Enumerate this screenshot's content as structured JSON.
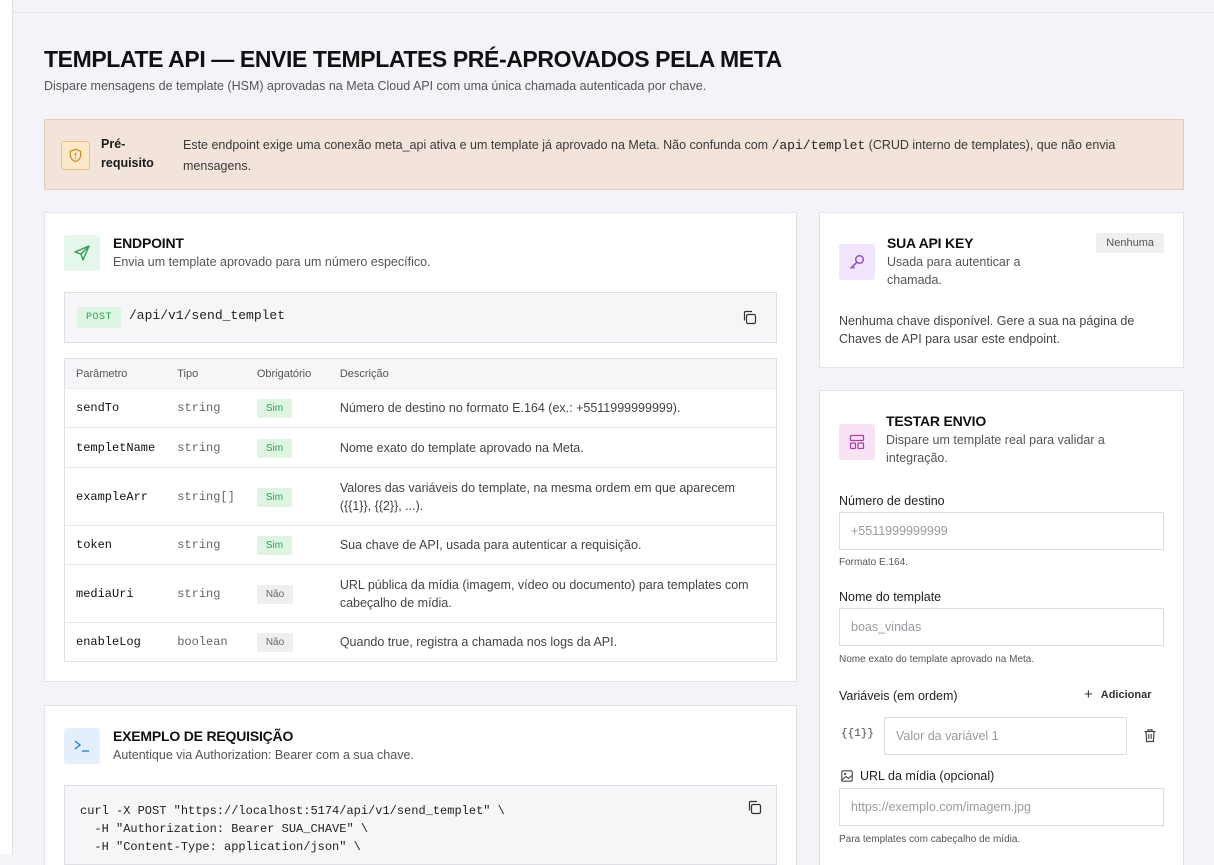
{
  "page": {
    "title": "TEMPLATE API — ENVIE TEMPLATES PRÉ-APROVADOS PELA META",
    "subtitle": "Dispare mensagens de template (HSM) aprovadas na Meta Cloud API com uma única chamada autenticada por chave."
  },
  "prereq": {
    "label": "Pré-requisito",
    "text_before": "Este endpoint exige uma conexão meta_api ativa e um template já aprovado na Meta. Não confunda com ",
    "code": "/api/templet",
    "text_after": " (CRUD interno de templates), que não envia mensagens."
  },
  "endpoint": {
    "title": "ENDPOINT",
    "subtitle": "Envia um template aprovado para um número específico.",
    "method": "POST",
    "path": "/api/v1/send_templet",
    "table": {
      "headers": [
        "Parâmetro",
        "Tipo",
        "Obrigatório",
        "Descrição"
      ],
      "rows": [
        {
          "name": "sendTo",
          "type": "string",
          "required": "Sim",
          "description": "Número de destino no formato E.164 (ex.: +5511999999999)."
        },
        {
          "name": "templetName",
          "type": "string",
          "required": "Sim",
          "description": "Nome exato do template aprovado na Meta."
        },
        {
          "name": "exampleArr",
          "type": "string[]",
          "required": "Sim",
          "description": "Valores das variáveis do template, na mesma ordem em que aparecem ({{1}}, {{2}}, ...)."
        },
        {
          "name": "token",
          "type": "string",
          "required": "Sim",
          "description": "Sua chave de API, usada para autenticar a requisição."
        },
        {
          "name": "mediaUri",
          "type": "string",
          "required": "Não",
          "description": "URL pública da mídia (imagem, vídeo ou documento) para templates com cabeçalho de mídia."
        },
        {
          "name": "enableLog",
          "type": "boolean",
          "required": "Não",
          "description": "Quando true, registra a chamada nos logs da API."
        }
      ]
    }
  },
  "example": {
    "title": "EXEMPLO DE REQUISIÇÃO",
    "subtitle": "Autentique via Authorization: Bearer com a sua chave.",
    "code": "curl -X POST \"https://localhost:5174/api/v1/send_templet\" \\\n  -H \"Authorization: Bearer SUA_CHAVE\" \\\n  -H \"Content-Type: application/json\" \\"
  },
  "apikey": {
    "title": "SUA API KEY",
    "subtitle": "Usada para autenticar a chamada.",
    "badge": "Nenhuma",
    "message": "Nenhuma chave disponível. Gere a sua na página de Chaves de API para usar este endpoint."
  },
  "test": {
    "title": "TESTAR ENVIO",
    "subtitle": "Dispare um template real para validar a integração.",
    "destino_label": "Número de destino",
    "destino_placeholder": "+5511999999999",
    "destino_hint": "Formato E.164.",
    "template_label": "Nome do template",
    "template_placeholder": "boas_vindas",
    "template_hint": "Nome exato do template aprovado na Meta.",
    "vars_label": "Variáveis (em ordem)",
    "add_label": "Adicionar",
    "var_token": "{{1}}",
    "var_placeholder": "Valor da variável 1",
    "media_label": "URL da mídia (opcional)",
    "media_placeholder": "https://exemplo.com/imagem.jpg",
    "media_hint": "Para templates com cabeçalho de mídia."
  },
  "colors": {
    "page_bg": "#f4f3f9",
    "prereq_bg": "#f2e4db",
    "success": "#2f9e58",
    "accent_purple": "#8a3fd1"
  }
}
